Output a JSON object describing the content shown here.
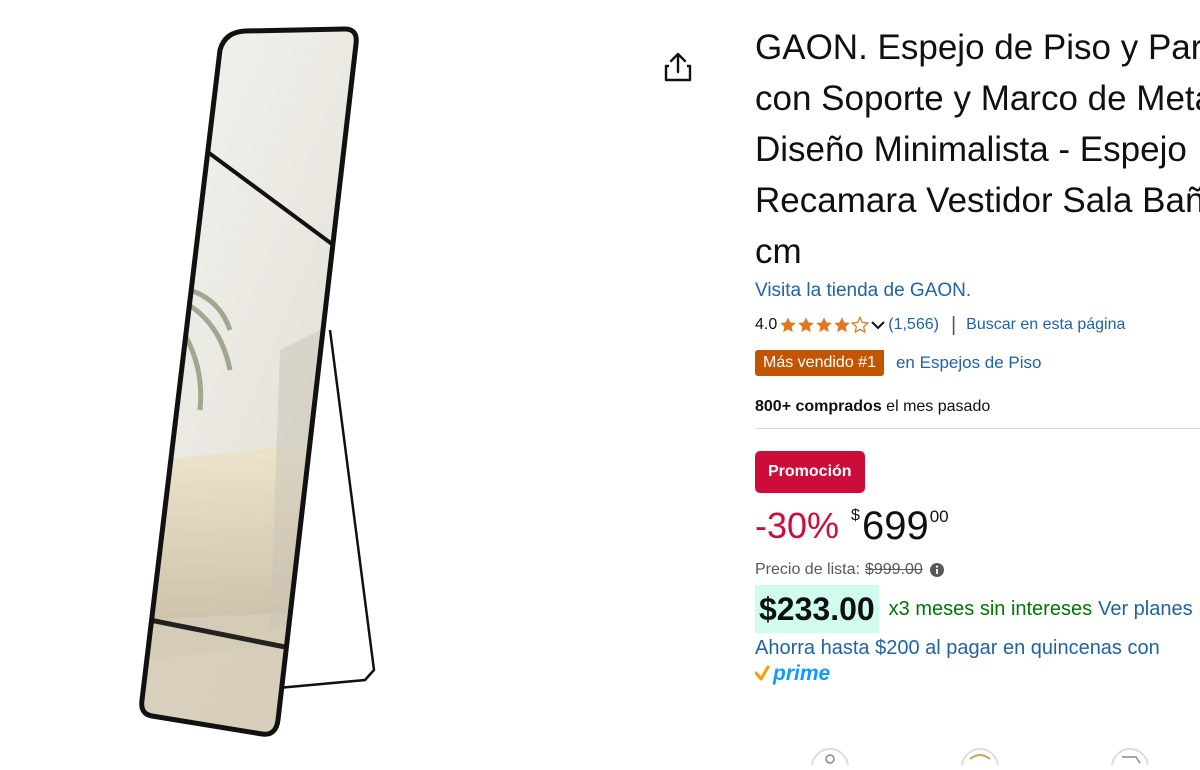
{
  "product": {
    "title_lines": [
      "GAON. Espejo de Piso y Pared",
      "con Soporte y Marco de Metal",
      "Diseño Minimalista - Espejo",
      "Recamara Vestidor Sala Baño",
      "cm"
    ],
    "store_link": "Visita la tienda de GAON.",
    "rating": "4.0",
    "rating_stars": 4,
    "review_count": "(1,566)",
    "search_page": "Buscar en esta página",
    "best_seller_badge": "Más vendido #1",
    "best_seller_category": "en Espejos de Piso",
    "bought_bold": "800+ comprados",
    "bought_rest": " el mes pasado",
    "promo_badge": "Promoción",
    "discount": "-30%",
    "price_currency": "$",
    "price_whole": "699",
    "price_cents": "00",
    "list_price_label": "Precio de lista:",
    "list_price": "$999.00",
    "installment_amount": "$233.00",
    "installment_text": "x3 meses sin intereses",
    "installment_link": "Ver planes",
    "savings_text": "Ahorra hasta $200 al pagar en quincenas con",
    "prime_label": "prime"
  },
  "colors": {
    "link": "#2162a1",
    "best_seller": "#c45500",
    "promo": "#cc0c39",
    "installment_bg": "#cffcee",
    "installment_text": "#007600",
    "prime": "#1399ff",
    "star": "#de7921"
  },
  "icons": {
    "share": "share-icon",
    "chevron": "chevron-down-icon",
    "info": "info-icon",
    "prime_check": "prime-check-icon"
  }
}
